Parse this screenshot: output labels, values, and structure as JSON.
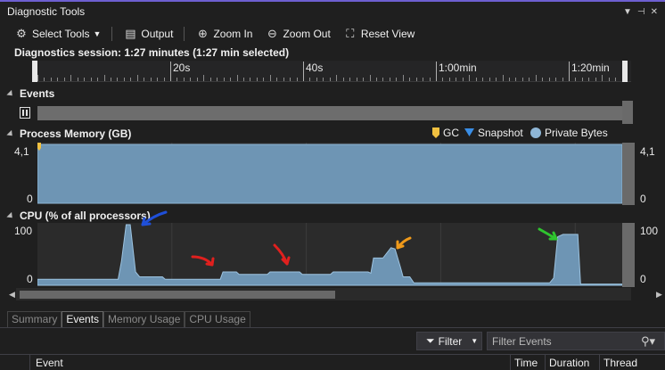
{
  "window": {
    "title": "Diagnostic Tools"
  },
  "toolbar": {
    "select_tools": "Select Tools",
    "output": "Output",
    "zoom_in": "Zoom In",
    "zoom_out": "Zoom Out",
    "reset_view": "Reset View"
  },
  "session": {
    "text": "Diagnostics session: 1:27 minutes (1:27 min selected)"
  },
  "ruler": {
    "labels": [
      "20s",
      "40s",
      "1:00min",
      "1:20min"
    ]
  },
  "events": {
    "title": "Events"
  },
  "memory": {
    "title": "Process Memory (GB)",
    "legend": {
      "gc": "GC",
      "snapshot": "Snapshot",
      "private_bytes": "Private Bytes"
    },
    "y_max_label": "4,1",
    "y_min_label": "0",
    "colors": {
      "gc": "#f0c040",
      "snapshot": "#3a8ee6",
      "private_bytes": "#8fb6d6",
      "fill": "#6e95b4"
    }
  },
  "cpu": {
    "title": "CPU (% of all processors)",
    "y_max_label": "100",
    "y_min_label": "0",
    "colors": {
      "fill": "#6e95b4",
      "line": "#9cc3e0"
    }
  },
  "tabs": [
    "Summary",
    "Events",
    "Memory Usage",
    "CPU Usage"
  ],
  "filter": {
    "button_label": "Filter",
    "placeholder": "Filter Events"
  },
  "grid": {
    "columns": [
      "Event",
      "Time",
      "Duration",
      "Thread"
    ]
  },
  "chart_data": [
    {
      "type": "area",
      "title": "Process Memory (GB)",
      "series": [
        {
          "name": "Private Bytes",
          "x": [
            0,
            87
          ],
          "values": [
            4.1,
            4.1
          ]
        }
      ],
      "ylim": [
        0,
        4.1
      ],
      "xlabel": "",
      "ylabel": ""
    },
    {
      "type": "area",
      "title": "CPU (% of all processors)",
      "series": [
        {
          "name": "",
          "x": [
            0,
            12.0,
            12.5,
            13.2,
            13.8,
            14.6,
            15.2,
            18.6,
            19.0,
            27.2,
            27.6,
            29.6,
            30.0,
            34.2,
            34.6,
            39.0,
            39.4,
            43.6,
            44.0,
            49.2,
            49.6,
            50.0,
            51.4,
            52.6,
            53.2,
            54.0,
            54.4,
            55.4,
            56.0,
            76.2,
            76.8,
            77.4,
            78.2,
            80.4,
            80.8,
            87
          ],
          "values": [
            10,
            10,
            40,
            100,
            100,
            22,
            14,
            14,
            10,
            10,
            22,
            22,
            18,
            18,
            22,
            22,
            18,
            18,
            22,
            22,
            20,
            45,
            45,
            62,
            60,
            30,
            14,
            14,
            4,
            4,
            12,
            80,
            84,
            84,
            2,
            2
          ]
        }
      ],
      "ylim": [
        0,
        100
      ],
      "xlabel": "",
      "ylabel": ""
    }
  ]
}
